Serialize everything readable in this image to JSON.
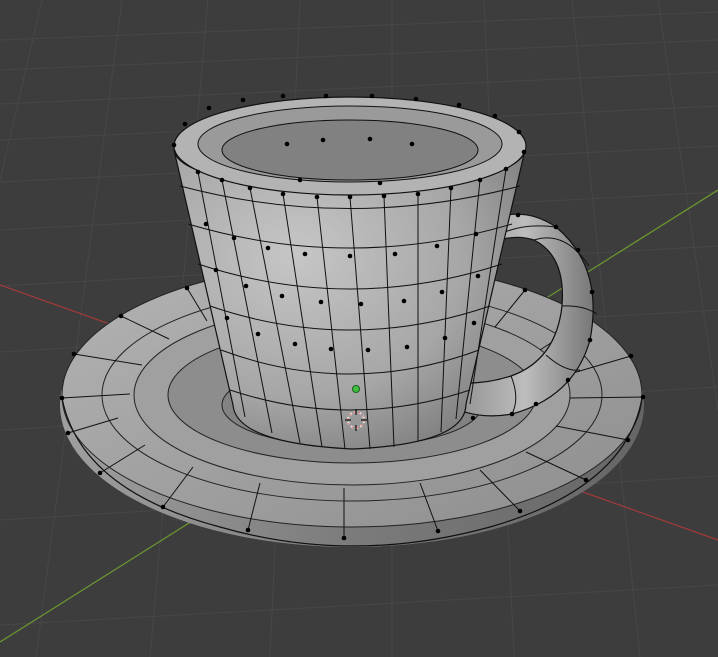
{
  "viewport": {
    "background": "#3d3d3d",
    "grid_color": "#474747",
    "x_axis_color": "#a33a3a",
    "y_axis_color": "#6c9a2f"
  },
  "model": {
    "object": "cup-and-saucer",
    "display": "wireframe-on-shaded",
    "surface_color": "#a9a9a9",
    "edge_color": "#111111",
    "vertex_color": "#000000"
  },
  "overlays": {
    "origin_color": "#3ec13e",
    "cursor_icon": "3d-cursor-icon"
  }
}
